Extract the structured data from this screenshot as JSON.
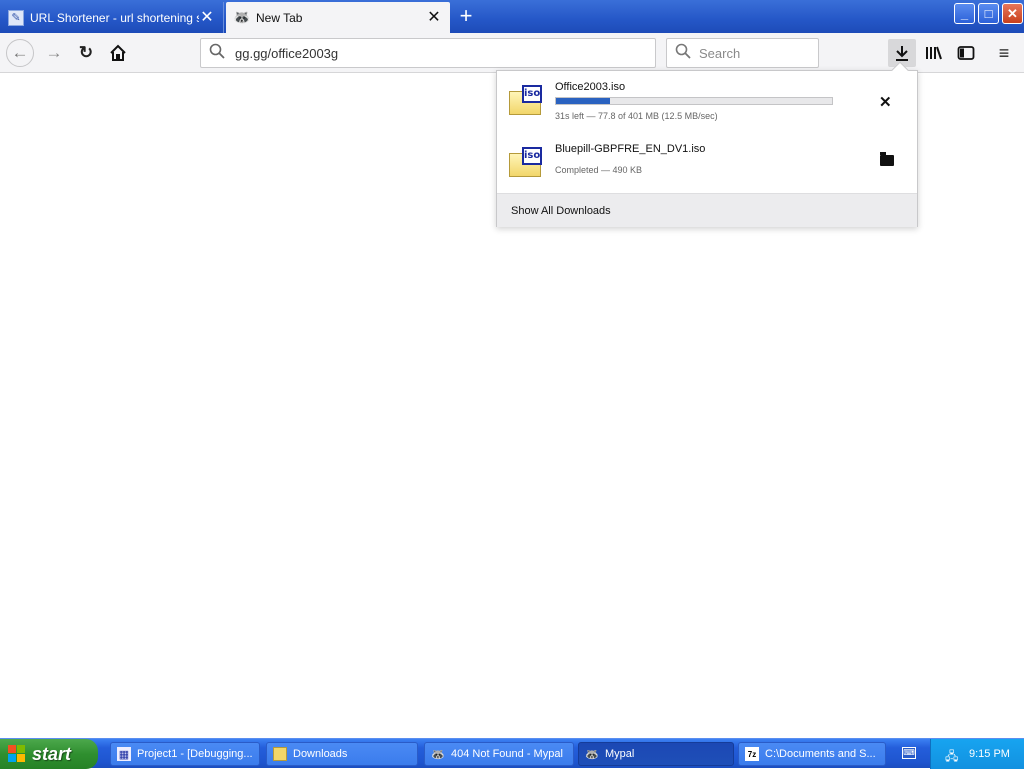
{
  "browser": {
    "tabs": [
      {
        "title": "URL Shortener - url shortening se",
        "active": false,
        "favicon": "page-icon"
      },
      {
        "title": "New Tab",
        "active": true,
        "favicon": "mypal-raccoon-icon"
      }
    ],
    "new_tab_icon": "+",
    "window_controls": {
      "minimize": "_",
      "maximize": "□",
      "close": "✕"
    }
  },
  "navbar": {
    "back": "←",
    "forward": "→",
    "reload": "↻",
    "home": "⌂",
    "url": "gg.gg/office2003g",
    "search_placeholder": "Search",
    "downloads_icon": "⭳",
    "library_icon": "|||\\",
    "sidebar_icon": "◧",
    "menu_icon": "≡"
  },
  "downloads_panel": {
    "items": [
      {
        "name": "Office2003.iso",
        "progress_fraction": 0.194,
        "status": "31s left — 77.8 of 401 MB (12.5 MB/sec)",
        "icon_label": "iso",
        "action_icon": "✕"
      },
      {
        "name": "Bluepill-GBPFRE_EN_DV1.iso",
        "status": "Completed — 490 KB",
        "icon_label": "iso",
        "action_icon": "open-folder-icon"
      }
    ],
    "show_all": "Show All Downloads"
  },
  "taskbar": {
    "start_label": "start",
    "tasks": [
      {
        "label": "Project1 - [Debugging...",
        "icon": "vb-project-icon"
      },
      {
        "label": "Downloads",
        "icon": "folder-icon"
      },
      {
        "label": "404 Not Found - Mypal",
        "icon": "mypal-raccoon-icon"
      },
      {
        "label": "Mypal",
        "icon": "mypal-raccoon-icon",
        "active": true
      },
      {
        "label": "C:\\Documents and S...",
        "icon": "7zip-icon"
      }
    ],
    "time": "9:15 PM",
    "colors": {
      "start_green": "#2f8f2f",
      "taskbar_blue": "#245edb",
      "tray_blue": "#17a4f0"
    }
  }
}
